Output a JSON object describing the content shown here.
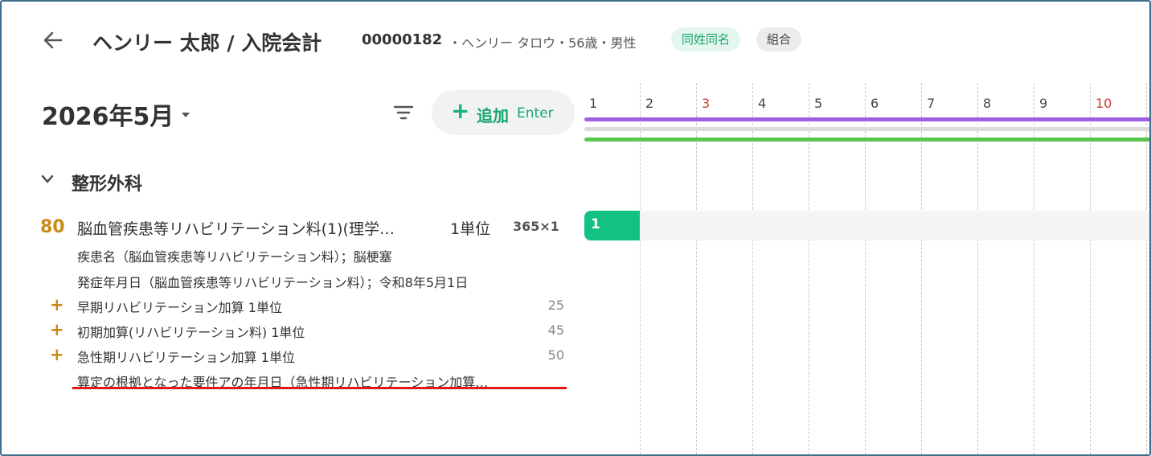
{
  "header": {
    "title": "ヘンリー 太郎 / 入院会計",
    "patient_id": "00000182",
    "patient_info": "・ヘンリー タロウ・56歳・男性",
    "badges": [
      "同姓同名",
      "組合"
    ],
    "back_icon": "arrow-left-icon"
  },
  "toolbar": {
    "month": "2026年5月",
    "filter_icon": "filter-icon",
    "add_label": "追加",
    "add_shortcut": "Enter"
  },
  "section": {
    "title": "整形外科",
    "item": {
      "points": "80",
      "name": "脳血管疾患等リハビリテーション料(1)(理学…",
      "unit": "1単位",
      "qty": "365×1",
      "details": [
        "疾患名（脳血管疾患等リハビリテーション料）；脳梗塞",
        "発症年月日（脳血管疾患等リハビリテーション料）；令和8年5月1日"
      ],
      "addons": [
        {
          "label": "早期リハビリテーション加算 1単位",
          "points": "25"
        },
        {
          "label": "初期加算(リハビリテーション料) 1単位",
          "points": "45"
        },
        {
          "label": "急性期リハビリテーション加算 1単位",
          "points": "50"
        }
      ],
      "last_line": "算定の根拠となった要件アの年月日（急性期リハビリテーション加算…"
    }
  },
  "calendar": {
    "days": [
      "1",
      "2",
      "3",
      "4",
      "5",
      "6",
      "7",
      "8",
      "9",
      "10"
    ],
    "sunday_days": [
      "3",
      "10"
    ],
    "cell_value": "1",
    "colors": {
      "bar_purple": "#a05ee0",
      "bar_gray": "#dcdcdc",
      "bar_green": "#5cc54f",
      "cell": "#13c282",
      "sunday": "#d8372f"
    }
  }
}
